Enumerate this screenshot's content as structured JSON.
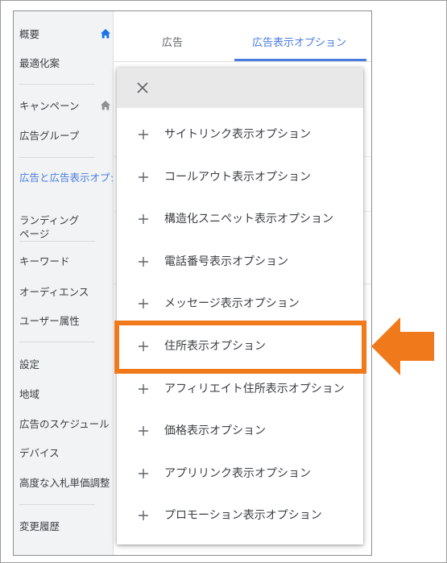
{
  "sidebar": {
    "items": [
      {
        "label": "概要"
      },
      {
        "label": "最適化案"
      },
      {
        "label": "キャンペーン"
      },
      {
        "label": "広告グループ"
      },
      {
        "label": "広告と広告表示オプション"
      },
      {
        "label": "ランディング\nページ"
      },
      {
        "label": "キーワード"
      },
      {
        "label": "オーディエンス"
      },
      {
        "label": "ユーザー属性"
      },
      {
        "label": "設定"
      },
      {
        "label": "地域"
      },
      {
        "label": "広告のスケジュール"
      },
      {
        "label": "デバイス"
      },
      {
        "label": "高度な入札単価調整"
      },
      {
        "label": "変更履歴"
      }
    ],
    "active_index": 4
  },
  "tabs": [
    {
      "label": "広告"
    },
    {
      "label": "広告表示オプション"
    }
  ],
  "menu": {
    "items": [
      {
        "label": "サイトリンク表示オプション"
      },
      {
        "label": "コールアウト表示オプション"
      },
      {
        "label": "構造化スニペット表示オプション"
      },
      {
        "label": "電話番号表示オプション"
      },
      {
        "label": "メッセージ表示オプション"
      },
      {
        "label": "住所表示オプション"
      },
      {
        "label": "アフィリエイト住所表示オプション"
      },
      {
        "label": "価格表示オプション"
      },
      {
        "label": "アプリリンク表示オプション"
      },
      {
        "label": "プロモーション表示オプション"
      }
    ],
    "highlighted_index": 5
  },
  "icons": {
    "home": "home-icon",
    "close": "close-icon",
    "add": "plus-icon",
    "pointer": "arrow-left-icon"
  },
  "colors": {
    "accent_blue": "#4a7ce0",
    "highlight_orange": "#f0791c",
    "sidebar_bg": "#f1f3f4",
    "menu_header_bg": "#e8e8e8"
  }
}
